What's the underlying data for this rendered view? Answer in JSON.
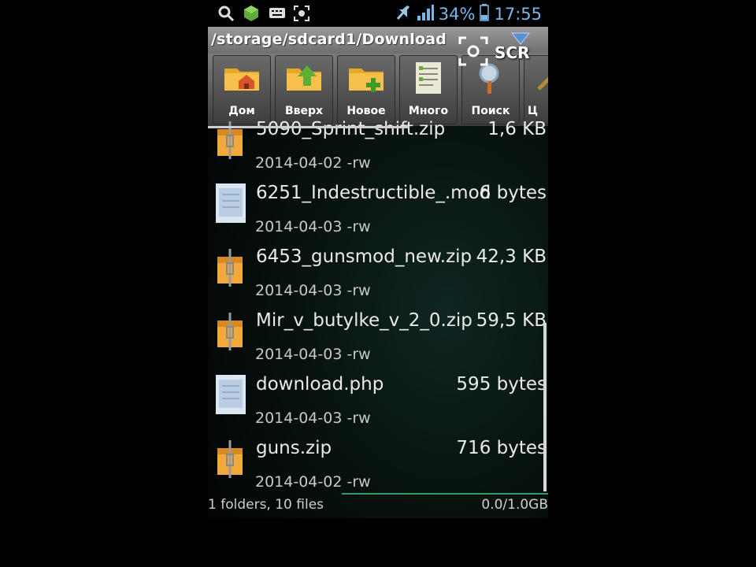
{
  "status_bar": {
    "icons_left": [
      "search-icon",
      "android-icon",
      "keyboard-icon",
      "screenshot-icon"
    ],
    "icons_right": [
      "mute-icon",
      "signal-icon"
    ],
    "battery": "34%",
    "time": "17:55",
    "accent": "#7ab7e8"
  },
  "path_bar": {
    "path": "/storage/sdcard1/Download"
  },
  "overlay": {
    "label": "SCR"
  },
  "toolbar": {
    "buttons": [
      {
        "label": "Дом",
        "icon": "home-folder-icon"
      },
      {
        "label": "Вверх",
        "icon": "up-folder-icon"
      },
      {
        "label": "Новое",
        "icon": "new-folder-icon"
      },
      {
        "label": "Много",
        "icon": "multi-select-icon"
      },
      {
        "label": "Поиск",
        "icon": "search-icon"
      },
      {
        "label": "Ц",
        "icon": "tools-icon"
      }
    ]
  },
  "files": [
    {
      "name": "5090_Sprint_shift.zip",
      "size": "1,6 KB",
      "date": "2014-04-02 -rw",
      "icon": "archive-icon"
    },
    {
      "name": "6251_Indestructible_.mod",
      "size": "6 bytes",
      "date": "2014-04-03 -rw",
      "icon": "document-icon"
    },
    {
      "name": "6453_gunsmod_new.zip",
      "size": "42,3 KB",
      "date": "2014-04-03 -rw",
      "icon": "archive-icon"
    },
    {
      "name": "Mir_v_butylke_v_2_0.zip",
      "size": "59,5 KB",
      "date": "2014-04-03 -rw",
      "icon": "archive-icon"
    },
    {
      "name": "download.php",
      "size": "595 bytes",
      "date": "2014-04-03 -rw",
      "icon": "document-icon"
    },
    {
      "name": "guns.zip",
      "size": "716 bytes",
      "date": "2014-04-02 -rw",
      "icon": "archive-icon"
    }
  ],
  "footer": {
    "count": "1 folders, 10 files",
    "storage": "0.0/1.0GB"
  }
}
